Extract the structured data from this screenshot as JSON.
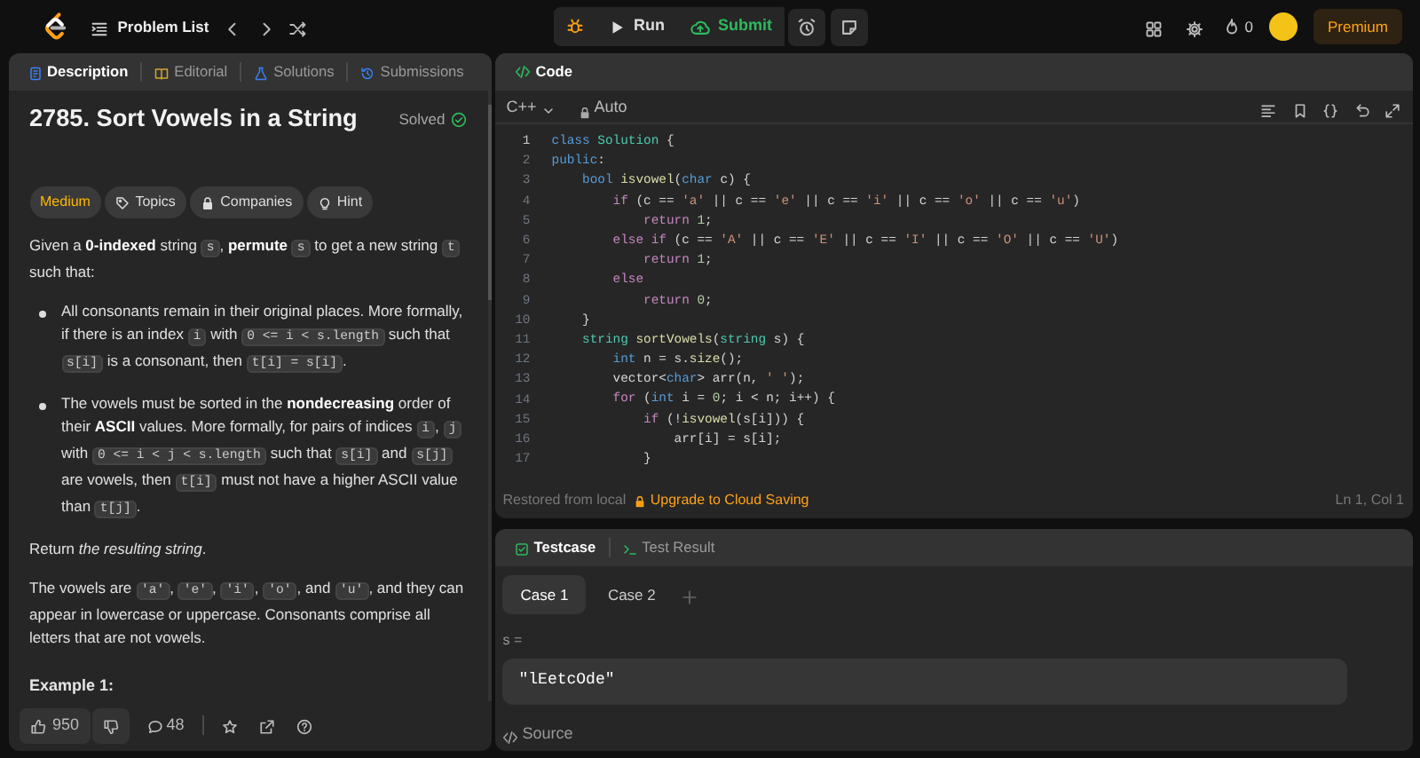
{
  "top_bar": {
    "problem_list": "Problem List",
    "run": "Run",
    "submit": "Submit",
    "streak": "0",
    "premium": "Premium"
  },
  "description_panel": {
    "tabs": [
      {
        "label": "Description",
        "kind": "description",
        "selected": true
      },
      {
        "label": "Editorial",
        "kind": "editorial",
        "selected": false
      },
      {
        "label": "Solutions",
        "kind": "solutions",
        "selected": false
      },
      {
        "label": "Submissions",
        "kind": "submissions",
        "selected": false
      }
    ],
    "title": "2785. Sort Vowels in a String",
    "status": "Solved",
    "tags": [
      {
        "label": "Medium",
        "kind": "difficulty"
      },
      {
        "label": "Topics",
        "kind": "topics"
      },
      {
        "label": "Companies",
        "kind": "companies"
      },
      {
        "label": "Hint",
        "kind": "hint"
      }
    ],
    "paragraphs": [
      {
        "kind": "para",
        "segments": [
          {
            "kind": "text",
            "text": "Given a **0-indexed** string "
          },
          {
            "kind": "code",
            "text": "s"
          },
          {
            "kind": "text",
            "text": ", **permute** "
          },
          {
            "kind": "code",
            "text": "s"
          },
          {
            "kind": "text",
            "text": " to get a new string "
          },
          {
            "kind": "code",
            "text": "t"
          },
          {
            "kind": "text",
            "text": " such that:"
          }
        ]
      },
      {
        "kind": "bullet",
        "segments": [
          {
            "kind": "text",
            "text": "All consonants remain in their original places. More formally, if there is an index "
          },
          {
            "kind": "code",
            "text": "i"
          },
          {
            "kind": "text",
            "text": " with "
          },
          {
            "kind": "code",
            "text": "0 <= i < s.length"
          },
          {
            "kind": "text",
            "text": " such that "
          },
          {
            "kind": "code",
            "text": "s[i]"
          },
          {
            "kind": "text",
            "text": " is a consonant, then "
          },
          {
            "kind": "code",
            "text": "t[i] = s[i]"
          },
          {
            "kind": "text",
            "text": "."
          }
        ]
      },
      {
        "kind": "bullet",
        "segments": [
          {
            "kind": "text",
            "text": "The vowels must be sorted in the **nondecreasing** order of their **ASCII** values. More formally, for pairs of indices "
          },
          {
            "kind": "code",
            "text": "i"
          },
          {
            "kind": "text",
            "text": ", "
          },
          {
            "kind": "code",
            "text": "j"
          },
          {
            "kind": "text",
            "text": " with "
          },
          {
            "kind": "code",
            "text": "0 <= i < j < s.length"
          },
          {
            "kind": "text",
            "text": " such that "
          },
          {
            "kind": "code",
            "text": "s[i]"
          },
          {
            "kind": "text",
            "text": " and "
          },
          {
            "kind": "code",
            "text": "s[j]"
          },
          {
            "kind": "text",
            "text": " are vowels, then "
          },
          {
            "kind": "code",
            "text": "t[i]"
          },
          {
            "kind": "text",
            "text": " must not have a higher ASCII value than "
          },
          {
            "kind": "code",
            "text": "t[j]"
          },
          {
            "kind": "text",
            "text": "."
          }
        ]
      },
      {
        "kind": "para",
        "segments": [
          {
            "kind": "text",
            "text": "Return *the resulting string*."
          }
        ]
      },
      {
        "kind": "para",
        "segments": [
          {
            "kind": "text",
            "text": "The vowels are "
          },
          {
            "kind": "code",
            "text": "'a'"
          },
          {
            "kind": "text",
            "text": ", "
          },
          {
            "kind": "code",
            "text": "'e'"
          },
          {
            "kind": "text",
            "text": ", "
          },
          {
            "kind": "code",
            "text": "'i'"
          },
          {
            "kind": "text",
            "text": ", "
          },
          {
            "kind": "code",
            "text": "'o'"
          },
          {
            "kind": "text",
            "text": ", and "
          },
          {
            "kind": "code",
            "text": "'u'"
          },
          {
            "kind": "text",
            "text": ", and they can appear in lowercase or uppercase. Consonants comprise all letters that are not vowels."
          }
        ]
      }
    ],
    "section_heading": "Example 1:",
    "likes": "950",
    "comments": "48"
  },
  "code_panel": {
    "tab": "Code",
    "language": "C++",
    "mode": "Auto",
    "lines": [
      {
        "n": "1",
        "tokens": [
          {
            "kind": "keyword",
            "text": "class "
          },
          {
            "kind": "type",
            "text": "Solution"
          },
          {
            "kind": "plain",
            "text": " {"
          }
        ]
      },
      {
        "n": "2",
        "tokens": [
          {
            "kind": "keyword",
            "text": "public"
          },
          {
            "kind": "plain",
            "text": ":"
          }
        ]
      },
      {
        "n": "3",
        "tokens": [
          {
            "kind": "keyword",
            "text": "    bool "
          },
          {
            "kind": "function",
            "text": "isvowel"
          },
          {
            "kind": "plain",
            "text": "("
          },
          {
            "kind": "keyword",
            "text": "char"
          },
          {
            "kind": "plain",
            "text": " c) {"
          }
        ]
      },
      {
        "n": "4",
        "tokens": [
          {
            "kind": "control",
            "text": "        if"
          },
          {
            "kind": "plain",
            "text": " (c == "
          },
          {
            "kind": "string",
            "text": "'a'"
          },
          {
            "kind": "plain",
            "text": " || c == "
          },
          {
            "kind": "string",
            "text": "'e'"
          },
          {
            "kind": "plain",
            "text": " || c == "
          },
          {
            "kind": "string",
            "text": "'i'"
          },
          {
            "kind": "plain",
            "text": " || c == "
          },
          {
            "kind": "string",
            "text": "'o'"
          },
          {
            "kind": "plain",
            "text": " || c == "
          },
          {
            "kind": "string",
            "text": "'u'"
          },
          {
            "kind": "plain",
            "text": ")"
          }
        ]
      },
      {
        "n": "5",
        "tokens": [
          {
            "kind": "control",
            "text": "            return "
          },
          {
            "kind": "number",
            "text": "1"
          },
          {
            "kind": "plain",
            "text": ";"
          }
        ]
      },
      {
        "n": "6",
        "tokens": [
          {
            "kind": "control",
            "text": "        else if"
          },
          {
            "kind": "plain",
            "text": " (c == "
          },
          {
            "kind": "string",
            "text": "'A'"
          },
          {
            "kind": "plain",
            "text": " || c == "
          },
          {
            "kind": "string",
            "text": "'E'"
          },
          {
            "kind": "plain",
            "text": " || c == "
          },
          {
            "kind": "string",
            "text": "'I'"
          },
          {
            "kind": "plain",
            "text": " || c == "
          },
          {
            "kind": "string",
            "text": "'O'"
          },
          {
            "kind": "plain",
            "text": " || c == "
          },
          {
            "kind": "string",
            "text": "'U'"
          },
          {
            "kind": "plain",
            "text": ")"
          }
        ]
      },
      {
        "n": "7",
        "tokens": [
          {
            "kind": "control",
            "text": "            return "
          },
          {
            "kind": "number",
            "text": "1"
          },
          {
            "kind": "plain",
            "text": ";"
          }
        ]
      },
      {
        "n": "8",
        "tokens": [
          {
            "kind": "control",
            "text": "        else"
          }
        ]
      },
      {
        "n": "9",
        "tokens": [
          {
            "kind": "control",
            "text": "            return "
          },
          {
            "kind": "number",
            "text": "0"
          },
          {
            "kind": "plain",
            "text": ";"
          }
        ]
      },
      {
        "n": "10",
        "tokens": [
          {
            "kind": "plain",
            "text": "    }"
          }
        ]
      },
      {
        "n": "11",
        "tokens": [
          {
            "kind": "type",
            "text": "    string "
          },
          {
            "kind": "function",
            "text": "sortVowels"
          },
          {
            "kind": "plain",
            "text": "("
          },
          {
            "kind": "type",
            "text": "string"
          },
          {
            "kind": "plain",
            "text": " s) {"
          }
        ]
      },
      {
        "n": "12",
        "tokens": [
          {
            "kind": "keyword",
            "text": "        int"
          },
          {
            "kind": "plain",
            "text": " n = s."
          },
          {
            "kind": "function",
            "text": "size"
          },
          {
            "kind": "plain",
            "text": "();"
          }
        ]
      },
      {
        "n": "13",
        "tokens": [
          {
            "kind": "plain",
            "text": "        vector<"
          },
          {
            "kind": "keyword",
            "text": "char"
          },
          {
            "kind": "plain",
            "text": "> arr(n, "
          },
          {
            "kind": "string",
            "text": "' '"
          },
          {
            "kind": "plain",
            "text": ");"
          }
        ]
      },
      {
        "n": "14",
        "tokens": [
          {
            "kind": "control",
            "text": "        for"
          },
          {
            "kind": "plain",
            "text": " ("
          },
          {
            "kind": "keyword",
            "text": "int"
          },
          {
            "kind": "plain",
            "text": " i = "
          },
          {
            "kind": "number",
            "text": "0"
          },
          {
            "kind": "plain",
            "text": "; i < n; i++) {"
          }
        ]
      },
      {
        "n": "15",
        "tokens": [
          {
            "kind": "control",
            "text": "            if"
          },
          {
            "kind": "plain",
            "text": " (!"
          },
          {
            "kind": "function",
            "text": "isvowel"
          },
          {
            "kind": "plain",
            "text": "(s[i])) {"
          }
        ]
      },
      {
        "n": "16",
        "tokens": [
          {
            "kind": "plain",
            "text": "                arr[i] = s[i];"
          }
        ]
      },
      {
        "n": "17",
        "tokens": [
          {
            "kind": "plain",
            "text": "            }"
          }
        ]
      }
    ],
    "status_left": "Restored from local",
    "upgrade": "Upgrade to Cloud Saving",
    "cursor": "Ln 1, Col 1"
  },
  "testcase_panel": {
    "tabs": [
      {
        "label": "Testcase",
        "kind": "testcase",
        "selected": true
      },
      {
        "label": "Test Result",
        "kind": "result",
        "selected": false
      }
    ],
    "cases": [
      {
        "label": "Case 1",
        "selected": true
      },
      {
        "label": "Case 2",
        "selected": false
      }
    ],
    "param_label": "s =",
    "param_value": "\"lEetcOde\"",
    "source": "Source"
  }
}
